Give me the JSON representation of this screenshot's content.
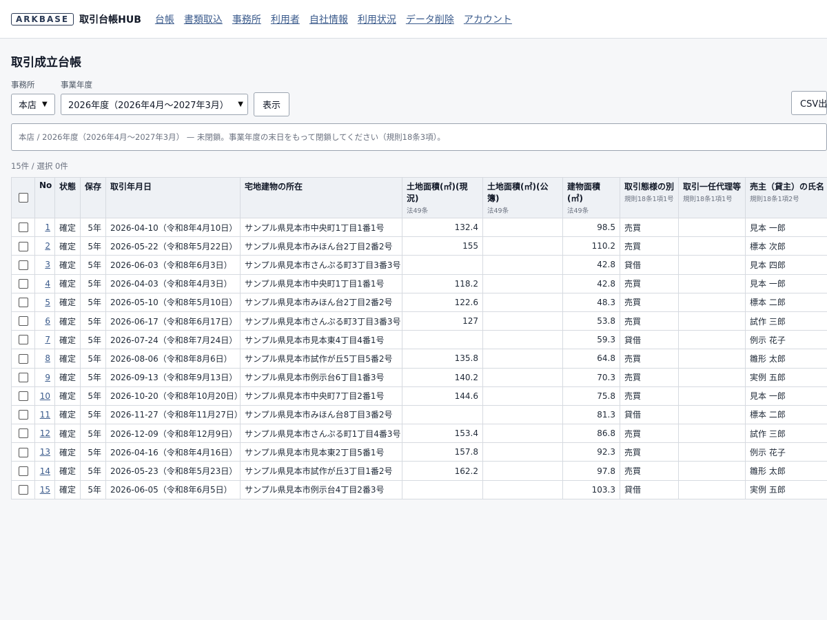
{
  "app": {
    "logo": "ARKBASE",
    "name": "取引台帳HUB"
  },
  "nav": [
    "台帳",
    "書類取込",
    "事務所",
    "利用者",
    "自社情報",
    "利用状況",
    "データ削除",
    "アカウント"
  ],
  "page_title": "取引成立台帳",
  "filters": {
    "office_label": "事務所",
    "office_value": "本店",
    "year_label": "事業年度",
    "year_value": "2026年度（2026年4月〜2027年3月）",
    "show_button": "表示",
    "csv_button": "CSV出"
  },
  "notice": "本店 / 2026年度（2026年4月〜2027年3月） — 未閉鎖。事業年度の末日をもって閉鎖してください（規則18条3項）。",
  "count": "15件 / 選択 0件",
  "table": {
    "headers": [
      {
        "label": "",
        "sub": ""
      },
      {
        "label": "No",
        "sub": ""
      },
      {
        "label": "状態",
        "sub": ""
      },
      {
        "label": "保存",
        "sub": ""
      },
      {
        "label": "取引年月日",
        "sub": ""
      },
      {
        "label": "宅地建物の所在",
        "sub": ""
      },
      {
        "label": "土地面積(㎡)(現況)",
        "sub": "法49条"
      },
      {
        "label": "土地面積(㎡)(公簿)",
        "sub": "法49条"
      },
      {
        "label": "建物面積(㎡)",
        "sub": "法49条"
      },
      {
        "label": "取引態様の別",
        "sub": "規則18条1項1号"
      },
      {
        "label": "取引一任代理等",
        "sub": "規則18条1項1号"
      },
      {
        "label": "売主（貸主）の氏名",
        "sub": "規則18条1項2号"
      }
    ],
    "rows": [
      {
        "no": "1",
        "status": "確定",
        "retention": "5年",
        "date": "2026-04-10（令和8年4月10日）",
        "location": "サンプル県見本市中央町1丁目1番1号",
        "land_actual": "132.4",
        "land_registry": "",
        "building": "98.5",
        "type": "売買",
        "agency": "",
        "seller": "見本 一郎"
      },
      {
        "no": "2",
        "status": "確定",
        "retention": "5年",
        "date": "2026-05-22（令和8年5月22日）",
        "location": "サンプル県見本市みほん台2丁目2番2号",
        "land_actual": "155",
        "land_registry": "",
        "building": "110.2",
        "type": "売買",
        "agency": "",
        "seller": "標本 次郎"
      },
      {
        "no": "3",
        "status": "確定",
        "retention": "5年",
        "date": "2026-06-03（令和8年6月3日）",
        "location": "サンプル県見本市さんぷる町3丁目3番3号",
        "land_actual": "",
        "land_registry": "",
        "building": "42.8",
        "type": "貸借",
        "agency": "",
        "seller": "見本 四郎"
      },
      {
        "no": "4",
        "status": "確定",
        "retention": "5年",
        "date": "2026-04-03（令和8年4月3日）",
        "location": "サンプル県見本市中央町1丁目1番1号",
        "land_actual": "118.2",
        "land_registry": "",
        "building": "42.8",
        "type": "売買",
        "agency": "",
        "seller": "見本 一郎"
      },
      {
        "no": "5",
        "status": "確定",
        "retention": "5年",
        "date": "2026-05-10（令和8年5月10日）",
        "location": "サンプル県見本市みほん台2丁目2番2号",
        "land_actual": "122.6",
        "land_registry": "",
        "building": "48.3",
        "type": "売買",
        "agency": "",
        "seller": "標本 二郎"
      },
      {
        "no": "6",
        "status": "確定",
        "retention": "5年",
        "date": "2026-06-17（令和8年6月17日）",
        "location": "サンプル県見本市さんぷる町3丁目3番3号",
        "land_actual": "127",
        "land_registry": "",
        "building": "53.8",
        "type": "売買",
        "agency": "",
        "seller": "試作 三郎"
      },
      {
        "no": "7",
        "status": "確定",
        "retention": "5年",
        "date": "2026-07-24（令和8年7月24日）",
        "location": "サンプル県見本市見本東4丁目4番1号",
        "land_actual": "",
        "land_registry": "",
        "building": "59.3",
        "type": "貸借",
        "agency": "",
        "seller": "例示 花子"
      },
      {
        "no": "8",
        "status": "確定",
        "retention": "5年",
        "date": "2026-08-06（令和8年8月6日）",
        "location": "サンプル県見本市試作が丘5丁目5番2号",
        "land_actual": "135.8",
        "land_registry": "",
        "building": "64.8",
        "type": "売買",
        "agency": "",
        "seller": "雛形 太郎"
      },
      {
        "no": "9",
        "status": "確定",
        "retention": "5年",
        "date": "2026-09-13（令和8年9月13日）",
        "location": "サンプル県見本市例示台6丁目1番3号",
        "land_actual": "140.2",
        "land_registry": "",
        "building": "70.3",
        "type": "売買",
        "agency": "",
        "seller": "実例 五郎"
      },
      {
        "no": "10",
        "status": "確定",
        "retention": "5年",
        "date": "2026-10-20（令和8年10月20日）",
        "location": "サンプル県見本市中央町7丁目2番1号",
        "land_actual": "144.6",
        "land_registry": "",
        "building": "75.8",
        "type": "売買",
        "agency": "",
        "seller": "見本 一郎"
      },
      {
        "no": "11",
        "status": "確定",
        "retention": "5年",
        "date": "2026-11-27（令和8年11月27日）",
        "location": "サンプル県見本市みほん台8丁目3番2号",
        "land_actual": "",
        "land_registry": "",
        "building": "81.3",
        "type": "貸借",
        "agency": "",
        "seller": "標本 二郎"
      },
      {
        "no": "12",
        "status": "確定",
        "retention": "5年",
        "date": "2026-12-09（令和8年12月9日）",
        "location": "サンプル県見本市さんぷる町1丁目4番3号",
        "land_actual": "153.4",
        "land_registry": "",
        "building": "86.8",
        "type": "売買",
        "agency": "",
        "seller": "試作 三郎"
      },
      {
        "no": "13",
        "status": "確定",
        "retention": "5年",
        "date": "2026-04-16（令和8年4月16日）",
        "location": "サンプル県見本市見本東2丁目5番1号",
        "land_actual": "157.8",
        "land_registry": "",
        "building": "92.3",
        "type": "売買",
        "agency": "",
        "seller": "例示 花子"
      },
      {
        "no": "14",
        "status": "確定",
        "retention": "5年",
        "date": "2026-05-23（令和8年5月23日）",
        "location": "サンプル県見本市試作が丘3丁目1番2号",
        "land_actual": "162.2",
        "land_registry": "",
        "building": "97.8",
        "type": "売買",
        "agency": "",
        "seller": "雛形 太郎"
      },
      {
        "no": "15",
        "status": "確定",
        "retention": "5年",
        "date": "2026-06-05（令和8年6月5日）",
        "location": "サンプル県見本市例示台4丁目2番3号",
        "land_actual": "",
        "land_registry": "",
        "building": "103.3",
        "type": "貸借",
        "agency": "",
        "seller": "実例 五郎"
      }
    ]
  }
}
